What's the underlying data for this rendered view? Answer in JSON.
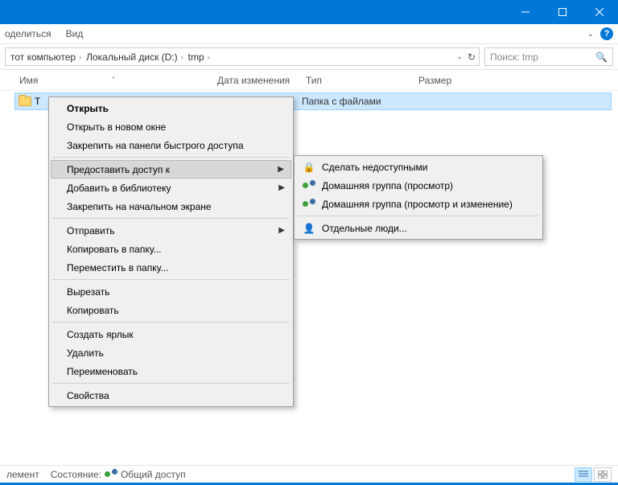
{
  "titlebar": {},
  "ribbon": {
    "share_tab": "оделиться",
    "view_tab": "Вид"
  },
  "breadcrumbs": {
    "pc": "тот компьютер",
    "disk": "Локальный диск (D:)",
    "folder": "tmp"
  },
  "search": {
    "placeholder": "Поиск: tmp"
  },
  "columns": {
    "name": "Имя",
    "date": "Дата изменения",
    "type": "Тип",
    "size": "Размер"
  },
  "row": {
    "name": "T",
    "type": "Папка с файлами"
  },
  "context": {
    "open": "Открыть",
    "open_new": "Открыть в новом окне",
    "pin_quick": "Закрепить на панели быстрого доступа",
    "grant_access": "Предоставить доступ к",
    "add_library": "Добавить в библиотеку",
    "pin_start": "Закрепить на начальном экране",
    "send_to": "Отправить",
    "copy_to_folder": "Копировать в папку...",
    "move_to_folder": "Переместить в папку...",
    "cut": "Вырезать",
    "copy": "Копировать",
    "create_shortcut": "Создать ярлык",
    "delete": "Удалить",
    "rename": "Переименовать",
    "properties": "Свойства"
  },
  "submenu": {
    "make_unavailable": "Сделать недоступными",
    "homegroup_view": "Домашняя группа (просмотр)",
    "homegroup_edit": "Домашняя группа (просмотр и изменение)",
    "specific_people": "Отдельные люди..."
  },
  "status": {
    "element": "лемент",
    "state_label": "Состояние:",
    "state_value": "Общий доступ"
  }
}
